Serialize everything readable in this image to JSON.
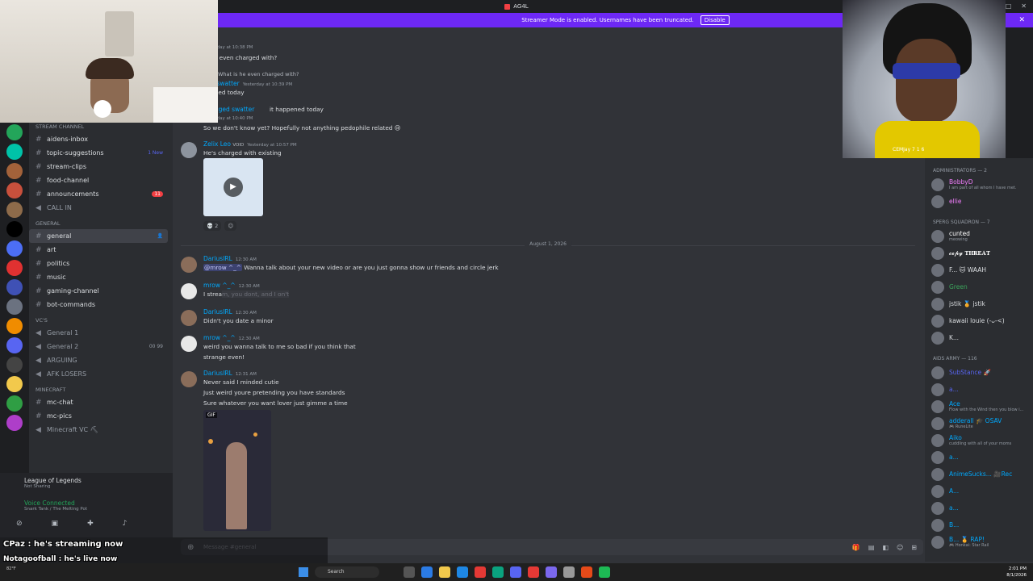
{
  "window": {
    "title": "AG4L"
  },
  "banner": {
    "text": "Streamer Mode is enabled. Usernames have been truncated.",
    "button": "Disable"
  },
  "sidebar": {
    "categories": {
      "stream": "STREAM CHANNEL",
      "general": "General",
      "vcs": "VC's",
      "minecraft": "Minecraft"
    },
    "channels": [
      {
        "label": "aidens-inbox"
      },
      {
        "label": "topic-suggestions",
        "badge": "1 New"
      },
      {
        "label": "stream-clips"
      },
      {
        "label": "food-channel"
      },
      {
        "label": "announcements",
        "badge": "11"
      },
      {
        "label": "CALL IN"
      },
      {
        "label": "general"
      },
      {
        "label": "art"
      },
      {
        "label": "politics"
      },
      {
        "label": "music"
      },
      {
        "label": "gaming-channel"
      },
      {
        "label": "bot-commands"
      },
      {
        "label": "General 1"
      },
      {
        "label": "General 2",
        "badge": "00 99"
      },
      {
        "label": "ARGUING"
      },
      {
        "label": "AFK LOSERS"
      },
      {
        "label": "mc-chat"
      },
      {
        "label": "mc-pics"
      },
      {
        "label": "Minecraft VC ⛏"
      }
    ]
  },
  "userpanel": {
    "game": "League of Legends",
    "game_sub": "Not Sharing",
    "voice": "Voice Connected",
    "voice_sub": "Snark Tank / The Melting Pot"
  },
  "chat": {
    "messages": [
      {
        "ts": "Yesterday at 10:38 PM",
        "text": "is he even charged with?"
      },
      {
        "reply_text": "What is he even charged with?",
        "name": "ged swatter",
        "ts": "Yesterday at 10:39 PM",
        "text": "ppened today"
      },
      {
        "name": "wranged swatter",
        "text": "it happened today"
      },
      {
        "ts": "Yesterday at 10:40 PM",
        "text": "So we don't know yet? Hopefully not anything pedophile related 😢"
      },
      {
        "name": "Zelix Leo",
        "tag": "VOID",
        "ts": "Yesterday at 10:57 PM",
        "text": "He's charged with existing",
        "reaction": "2"
      },
      {
        "name": "DariusIRL",
        "ts": "12:30 AM",
        "mention": "@mrow ^_^",
        "text": " Wanna talk about your new video or are you just gonna show ur friends and circle jerk"
      },
      {
        "name": "mrow ^_^",
        "ts": "12:30 AM",
        "text": "I strea",
        "spoiler": "m, you dont, and I on't"
      },
      {
        "name": "DariusIRL",
        "ts": "12:30 AM",
        "text": "Didn't you date a minor"
      },
      {
        "name": "mrow ^_^",
        "ts": "12:30 AM",
        "text": "weird you wanna talk to me so bad if you think that",
        "text2": "strange even!"
      },
      {
        "name": "DariusIRL",
        "ts": "12:31 AM",
        "text": "Never said I minded cutie",
        "text2": "Just weird youre pretending you have standards",
        "text3": "Sure whatever you want lover just gimme a time",
        "gif_tag": "GIF"
      }
    ],
    "divider": "August 1, 2026",
    "composer_placeholder": "Message #general"
  },
  "members": {
    "groups": [
      {
        "title": "Administrators — 2",
        "items": [
          {
            "name": "BobbyD",
            "sub": "I am part of all whom I have met.",
            "color": "#f47fff"
          },
          {
            "name": "ellie",
            "sub": "",
            "color": "#f47fff"
          }
        ]
      },
      {
        "title": "SPERG SQUADRON — 7",
        "items": [
          {
            "name": "cunted",
            "sub": "meowing",
            "color": "#ffffff"
          },
          {
            "name": "𝓬𝓮𝓹𝔂 𝐓𝐇𝐑𝐄𝐀𝐓",
            "sub": "",
            "color": "#ffffff"
          },
          {
            "name": "F... 🐱 WAAH",
            "sub": "",
            "color": "#dbdee1"
          },
          {
            "name": "Green",
            "sub": "",
            "color": "#3ba55c"
          },
          {
            "name": "jstik 🏅 jstik",
            "sub": "",
            "color": "#dbdee1"
          },
          {
            "name": "kawaii louie (-ᴗ-<)",
            "sub": "",
            "color": "#dbdee1"
          },
          {
            "name": "K...",
            "sub": "",
            "color": "#dbdee1"
          }
        ]
      },
      {
        "title": "AIDS ARMY — 116",
        "items": [
          {
            "name": "SubStance 🚀",
            "sub": "",
            "color": "#5865f2"
          },
          {
            "name": "a...",
            "sub": "",
            "color": "#5865f2"
          },
          {
            "name": "Ace",
            "sub": "Flow with the Wind then you blow i...",
            "color": "#00a8fc"
          },
          {
            "name": "adderall 🎓 OSAV",
            "sub": "🎮 RuneLite",
            "color": "#00a8fc"
          },
          {
            "name": "Aiko",
            "sub": "cuddling with all of your moms",
            "color": "#00a8fc"
          },
          {
            "name": "a...",
            "sub": "",
            "color": "#00a8fc"
          },
          {
            "name": "AnimeSucks... 🎥Rec",
            "sub": "",
            "color": "#00a8fc"
          },
          {
            "name": "A...",
            "sub": "",
            "color": "#00a8fc"
          },
          {
            "name": "a...",
            "sub": "",
            "color": "#00a8fc"
          },
          {
            "name": "B...",
            "sub": "",
            "color": "#00a8fc"
          },
          {
            "name": "B... 🏅 RAP!",
            "sub": "🎮 Honkai: Star Rail",
            "color": "#00a8fc"
          }
        ]
      }
    ]
  },
  "overlay": {
    "line1": "CPaz : he's streaming now",
    "line2": "Notagoofball : he's live now"
  },
  "taskbar": {
    "search": "Search",
    "time": "2:01 PM",
    "date": "8/1/2026",
    "weather": "82°F"
  },
  "cam": {
    "caption": "CEMJay 7 1 6"
  }
}
